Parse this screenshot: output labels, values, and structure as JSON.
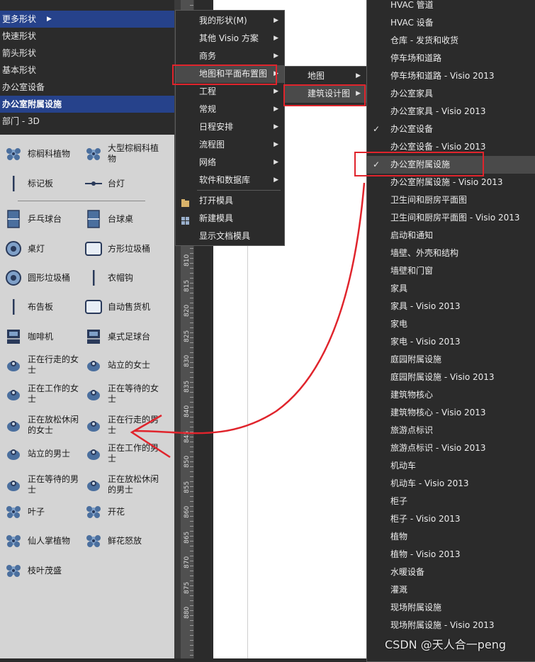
{
  "stencil_menu": {
    "items": [
      {
        "label": "更多形状",
        "selected": true,
        "has_arrow": true
      },
      {
        "label": "快速形状"
      },
      {
        "label": "箭头形状"
      },
      {
        "label": "基本形状"
      },
      {
        "label": "办公室设备"
      },
      {
        "label": "办公室附属设施",
        "selected": true,
        "bold": true
      },
      {
        "label": "部门 - 3D"
      }
    ]
  },
  "shapes": [
    {
      "label": "棕榈科植物",
      "icon": "palm-icon"
    },
    {
      "label": "大型棕榈科植物",
      "icon": "large-palm-icon"
    },
    {
      "label": "标记板",
      "icon": "marker-board-icon"
    },
    {
      "label": "台灯",
      "icon": "desk-lamp-icon"
    },
    {
      "label": "乒乓球台",
      "icon": "ping-pong-table-icon"
    },
    {
      "label": "台球桌",
      "icon": "pool-table-icon"
    },
    {
      "label": "桌灯",
      "icon": "table-lamp-icon"
    },
    {
      "label": "方形垃圾桶",
      "icon": "square-trash-icon"
    },
    {
      "label": "圆形垃圾桶",
      "icon": "round-trash-icon"
    },
    {
      "label": "衣帽钩",
      "icon": "coat-hook-icon"
    },
    {
      "label": "布告板",
      "icon": "bulletin-board-icon"
    },
    {
      "label": "自动售货机",
      "icon": "vending-machine-icon"
    },
    {
      "label": "咖啡机",
      "icon": "coffee-machine-icon"
    },
    {
      "label": "桌式足球台",
      "icon": "foosball-table-icon"
    },
    {
      "label": "正在行走的女士",
      "icon": "walking-woman-icon"
    },
    {
      "label": "站立的女士",
      "icon": "standing-woman-icon"
    },
    {
      "label": "正在工作的女士",
      "icon": "working-woman-icon"
    },
    {
      "label": "正在等待的女士",
      "icon": "waiting-woman-icon"
    },
    {
      "label": "正在放松休闲的女士",
      "icon": "relaxing-woman-icon"
    },
    {
      "label": "正在行走的男士",
      "icon": "walking-man-icon"
    },
    {
      "label": "站立的男士",
      "icon": "standing-man-icon"
    },
    {
      "label": "正在工作的男士",
      "icon": "working-man-icon"
    },
    {
      "label": "正在等待的男士",
      "icon": "waiting-man-icon"
    },
    {
      "label": "正在放松休闲的男士",
      "icon": "relaxing-man-icon"
    },
    {
      "label": "叶子",
      "icon": "leaf-icon"
    },
    {
      "label": "开花",
      "icon": "flower-icon"
    },
    {
      "label": "仙人掌植物",
      "icon": "cactus-icon"
    },
    {
      "label": "鲜花怒放",
      "icon": "blooming-flower-icon"
    },
    {
      "label": "枝叶茂盛",
      "icon": "lush-foliage-icon"
    }
  ],
  "ruler": {
    "labels": [
      "810",
      "815",
      "820",
      "825",
      "830",
      "835",
      "840",
      "845",
      "850",
      "855",
      "860",
      "865",
      "870",
      "875",
      "880"
    ]
  },
  "menu1": {
    "items": [
      {
        "label": "我的形状(M)",
        "submenu": true
      },
      {
        "label": "其他 Visio 方案",
        "submenu": true
      },
      {
        "label": "商务",
        "submenu": true
      },
      {
        "label": "地图和平面布置图",
        "submenu": true,
        "highlighted": true
      },
      {
        "label": "工程",
        "submenu": true
      },
      {
        "label": "常规",
        "submenu": true
      },
      {
        "label": "日程安排",
        "submenu": true
      },
      {
        "label": "流程图",
        "submenu": true
      },
      {
        "label": "网络",
        "submenu": true
      },
      {
        "label": "软件和数据库",
        "submenu": true
      },
      {
        "label": "打开模具",
        "icon": "open-stencil-icon"
      },
      {
        "label": "新建模具",
        "icon": "new-stencil-icon"
      },
      {
        "label": "显示文档模具"
      }
    ]
  },
  "menu2": {
    "items": [
      {
        "label": "地图",
        "submenu": true
      },
      {
        "label": "建筑设计图",
        "submenu": true,
        "highlighted": true
      }
    ]
  },
  "menu3": {
    "items": [
      {
        "label": "HVAC 管道"
      },
      {
        "label": "HVAC 设备"
      },
      {
        "label": "仓库 - 发货和收货"
      },
      {
        "label": "停车场和道路"
      },
      {
        "label": "停车场和道路 - Visio 2013"
      },
      {
        "label": "办公室家具"
      },
      {
        "label": "办公室家具 - Visio 2013"
      },
      {
        "label": "办公室设备",
        "checked": true
      },
      {
        "label": "办公室设备 - Visio 2013"
      },
      {
        "label": "办公室附属设施",
        "checked": true,
        "highlighted": true
      },
      {
        "label": "办公室附属设施 - Visio 2013"
      },
      {
        "label": "卫生间和厨房平面图"
      },
      {
        "label": "卫生间和厨房平面图 - Visio 2013"
      },
      {
        "label": "启动和通知"
      },
      {
        "label": "墙壁、外壳和结构"
      },
      {
        "label": "墙壁和门窗"
      },
      {
        "label": "家具"
      },
      {
        "label": "家具 - Visio 2013"
      },
      {
        "label": "家电"
      },
      {
        "label": "家电 - Visio 2013"
      },
      {
        "label": "庭园附属设施"
      },
      {
        "label": "庭园附属设施 - Visio 2013"
      },
      {
        "label": "建筑物核心"
      },
      {
        "label": "建筑物核心 - Visio 2013"
      },
      {
        "label": "旅游点标识"
      },
      {
        "label": "旅游点标识 - Visio 2013"
      },
      {
        "label": "机动车"
      },
      {
        "label": "机动车 - Visio 2013"
      },
      {
        "label": "柜子"
      },
      {
        "label": "柜子 - Visio 2013"
      },
      {
        "label": "植物"
      },
      {
        "label": "植物 - Visio 2013"
      },
      {
        "label": "水暖设备"
      },
      {
        "label": "灌溉"
      },
      {
        "label": "现场附属设施"
      },
      {
        "label": "现场附属设施 - Visio 2013"
      }
    ],
    "check_glyph": "✓"
  },
  "watermark": "CSDN @天人合一peng",
  "colors": {
    "annotation_red": "#e0242c",
    "selection_blue": "#26428b",
    "menu_bg": "#2b2b2b",
    "menu_highlight": "#4a4a4a"
  }
}
